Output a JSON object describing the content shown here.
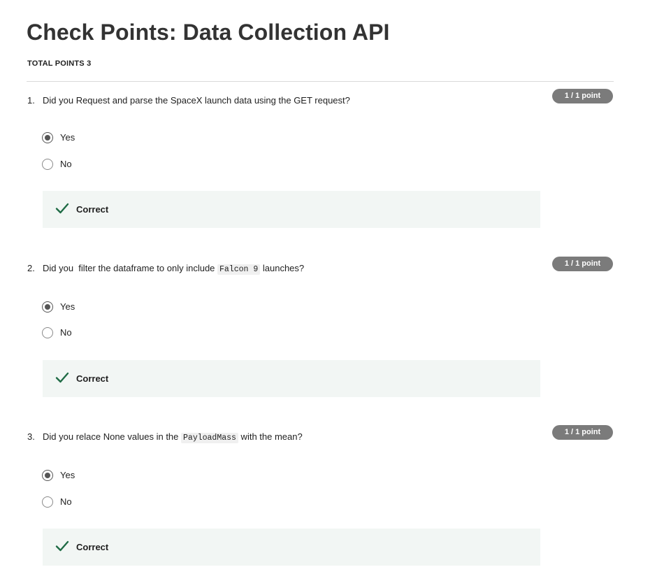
{
  "page": {
    "title": "Check Points: Data Collection API",
    "total_points": "TOTAL POINTS 3"
  },
  "colors": {
    "badge_bg": "#7b7b7b",
    "feedback_bg": "#f2f6f4",
    "check_green": "#1f6b45"
  },
  "questions": [
    {
      "number": "1.",
      "prompt_before": "Did you Request and parse the SpaceX launch data using the GET request?",
      "prompt_code": "",
      "prompt_after": "",
      "points": "1 / 1 point",
      "options": [
        {
          "label": "Yes",
          "selected": true
        },
        {
          "label": "No",
          "selected": false
        }
      ],
      "feedback": "Correct",
      "feedback_icon": "check-icon"
    },
    {
      "number": "2.",
      "prompt_before": "Did you  filter the dataframe to only include ",
      "prompt_code": "Falcon 9",
      "prompt_after": " launches?",
      "points": "1 / 1 point",
      "options": [
        {
          "label": "Yes",
          "selected": true
        },
        {
          "label": "No",
          "selected": false
        }
      ],
      "feedback": "Correct",
      "feedback_icon": "check-icon"
    },
    {
      "number": "3.",
      "prompt_before": "Did you relace None values in the ",
      "prompt_code": "PayloadMass",
      "prompt_after": " with the mean?",
      "points": "1 / 1 point",
      "options": [
        {
          "label": "Yes",
          "selected": true
        },
        {
          "label": "No",
          "selected": false
        }
      ],
      "feedback": "Correct",
      "feedback_icon": "check-icon"
    }
  ]
}
